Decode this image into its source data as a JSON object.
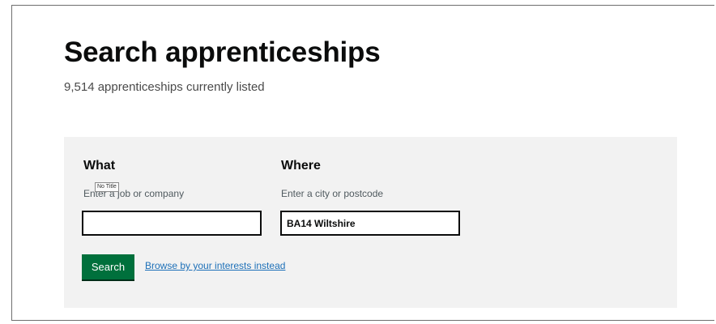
{
  "header": {
    "title": "Search apprenticeships",
    "listing_count": "9,514 apprenticeships currently listed"
  },
  "search": {
    "what": {
      "label": "What",
      "hint": "Enter a job or company",
      "value": ""
    },
    "where": {
      "label": "Where",
      "hint": "Enter a city or postcode",
      "value": "BA14 Wiltshire"
    },
    "tooltip": "No Title",
    "search_button_label": "Search",
    "browse_link_label": "Browse by your interests instead"
  },
  "colors": {
    "button_green": "#00703c",
    "link_blue": "#1d70b8",
    "panel_grey": "#f2f2f2"
  }
}
